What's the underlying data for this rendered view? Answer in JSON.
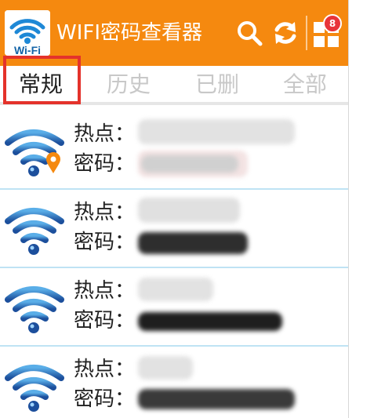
{
  "app": {
    "title": "WIFI密码查看器",
    "logo_text": "Wi-Fi",
    "badge_count": "8",
    "accent_color": "#f5890f",
    "icons": [
      "search-icon",
      "refresh-icon",
      "apps-grid-icon"
    ]
  },
  "tabs": [
    {
      "label": "常规",
      "active": true
    },
    {
      "label": "历史",
      "active": false
    },
    {
      "label": "已删",
      "active": false
    },
    {
      "label": "全部",
      "active": false
    }
  ],
  "entries": [
    {
      "hotspot_label": "热点：",
      "password_label": "密码：",
      "has_location": true
    },
    {
      "hotspot_label": "热点：",
      "password_label": "密码：",
      "has_location": false
    },
    {
      "hotspot_label": "热点：",
      "password_label": "密码：",
      "has_location": false
    },
    {
      "hotspot_label": "热点：",
      "password_label": "密码：",
      "has_location": false
    }
  ]
}
